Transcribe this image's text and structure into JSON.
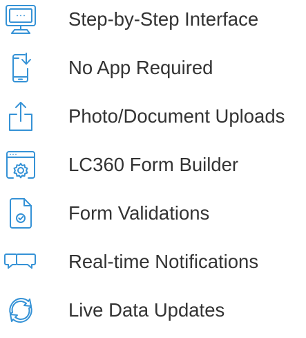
{
  "colors": {
    "icon_accent": "#3592D6",
    "text": "#333333",
    "background": "#FFFFFF"
  },
  "features": [
    {
      "icon": "monitor-icon",
      "label": "Step-by-Step Interface"
    },
    {
      "icon": "mobile-download-icon",
      "label": "No App Required"
    },
    {
      "icon": "upload-icon",
      "label": "Photo/Document Uploads"
    },
    {
      "icon": "browser-settings-icon",
      "label": "LC360 Form Builder"
    },
    {
      "icon": "document-check-icon",
      "label": "Form Validations"
    },
    {
      "icon": "chat-bubbles-icon",
      "label": "Real-time Notifications"
    },
    {
      "icon": "refresh-icon",
      "label": "Live Data Updates"
    }
  ]
}
